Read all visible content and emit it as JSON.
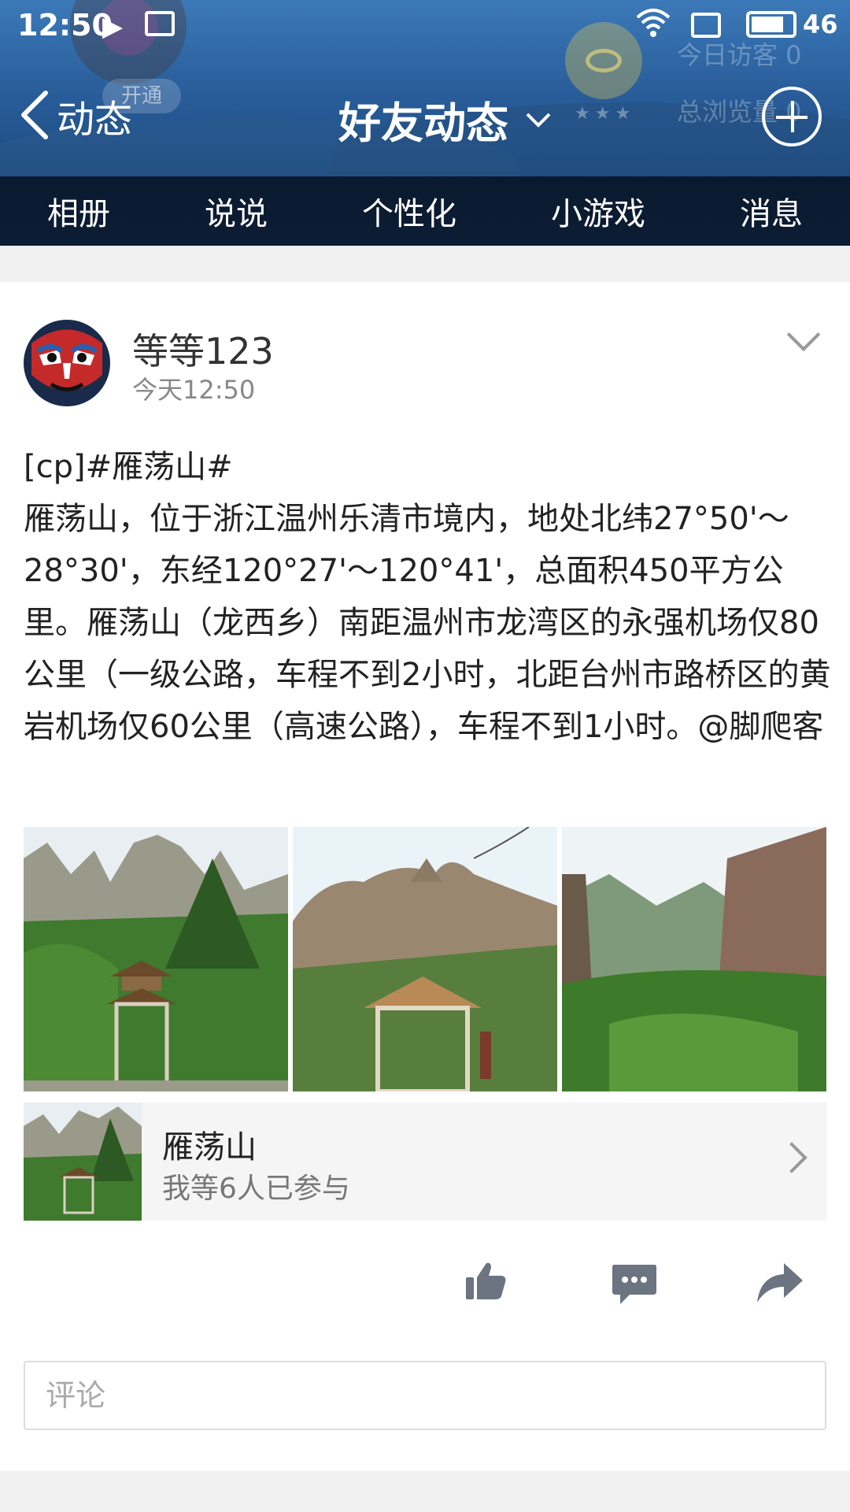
{
  "status_bar": {
    "time": "12:50",
    "battery": "46"
  },
  "header": {
    "back_label": "动态",
    "title": "好友动态",
    "badge_label": "开通",
    "visitors_today": "今日访客 0",
    "visitors_total": "总浏览量 0",
    "nav": [
      "相册",
      "说说",
      "个性化",
      "小游戏",
      "消息"
    ]
  },
  "post": {
    "username": "等等123",
    "time": "今天12:50",
    "text": "[cp]#雁荡山#\n雁荡山，位于浙江温州乐清市境内，地处北纬27°50'～28°30'，东经120°27'～120°41'，总面积450平方公里。雁荡山（龙西乡）南距温州市龙湾区的永强机场仅80公里（一级公路，车程不到2小时，北距台州市路桥区的黄岩机场仅60公里（高速公路），车程不到1小时。@脚爬客",
    "photos": [
      "photo-pavilion-cliffs",
      "photo-pavilion-rock",
      "photo-valley"
    ],
    "topic": {
      "name": "雁荡山",
      "participants": "我等6人已参与"
    }
  },
  "comment": {
    "placeholder": "评论"
  },
  "colors": {
    "header_dark": "#0c1c34",
    "icon_gray": "#6b7480",
    "accent": "#2a5f9c"
  }
}
